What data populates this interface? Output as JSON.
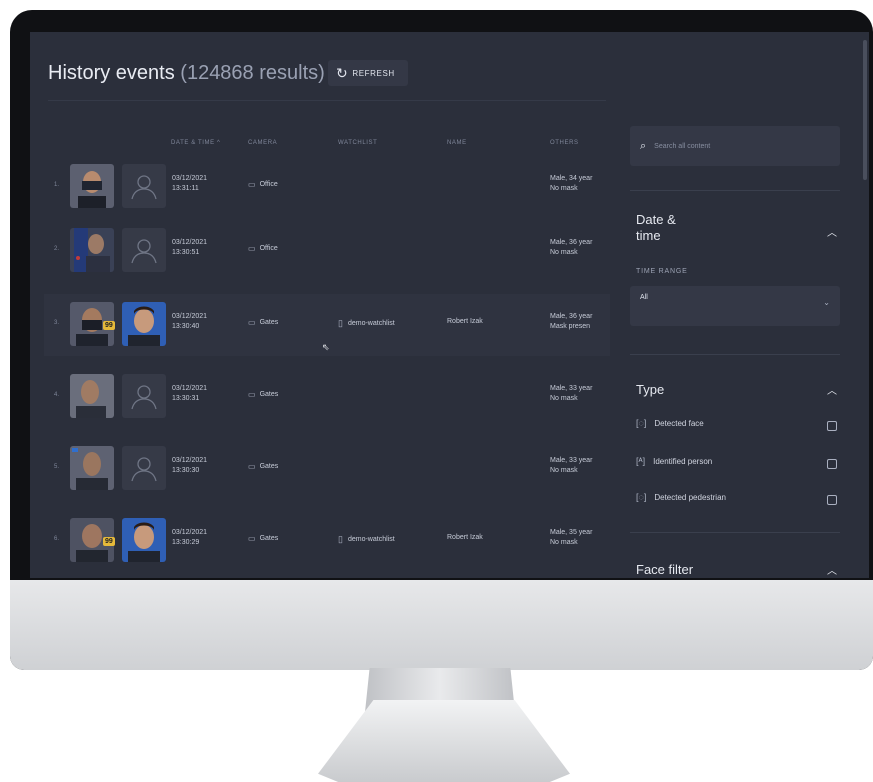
{
  "header": {
    "title": "History events",
    "result_count": "(124868 results)",
    "refresh_label": "REFRESH"
  },
  "table": {
    "columns": [
      "DATE & TIME ^",
      "CAMERA",
      "WATCHLIST",
      "NAME",
      "OTHERS"
    ],
    "rows": [
      {
        "num": "1.",
        "date": "03/12/2021",
        "time": "13:31:11",
        "camera": "Office",
        "watchlist": "",
        "name": "",
        "others1": "Male, 34 year",
        "others2": "No mask",
        "score": "",
        "identified": false
      },
      {
        "num": "2.",
        "date": "03/12/2021",
        "time": "13:30:51",
        "camera": "Office",
        "watchlist": "",
        "name": "",
        "others1": "Male, 36 year",
        "others2": "No mask",
        "score": "",
        "identified": false
      },
      {
        "num": "3.",
        "date": "03/12/2021",
        "time": "13:30:40",
        "camera": "Gates",
        "watchlist": "demo-watchlist",
        "name": "Robert Izak",
        "others1": "Male, 36 year",
        "others2": "Mask presen",
        "score": "99",
        "identified": true
      },
      {
        "num": "4.",
        "date": "03/12/2021",
        "time": "13:30:31",
        "camera": "Gates",
        "watchlist": "",
        "name": "",
        "others1": "Male, 33 year",
        "others2": "No mask",
        "score": "",
        "identified": false
      },
      {
        "num": "5.",
        "date": "03/12/2021",
        "time": "13:30:30",
        "camera": "Gates",
        "watchlist": "",
        "name": "",
        "others1": "Male, 33 year",
        "others2": "No mask",
        "score": "",
        "identified": false
      },
      {
        "num": "6.",
        "date": "03/12/2021",
        "time": "13:30:29",
        "camera": "Gates",
        "watchlist": "demo-watchlist",
        "name": "Robert Izak",
        "others1": "Male, 35 year",
        "others2": "No mask",
        "score": "99",
        "identified": true
      }
    ]
  },
  "filters": {
    "search_placeholder": "Search all content",
    "date_title_line1": "Date &",
    "date_title_line2": "time",
    "time_range_label": "TIME RANGE",
    "time_range_value": "All",
    "type_title": "Type",
    "type_options": [
      "Detected face",
      "Identified person",
      "Detected pedestrian"
    ],
    "face_filter_title": "Face filter"
  },
  "colors": {
    "background": "#2b2f3b",
    "score_badge": "#e5b93a"
  }
}
